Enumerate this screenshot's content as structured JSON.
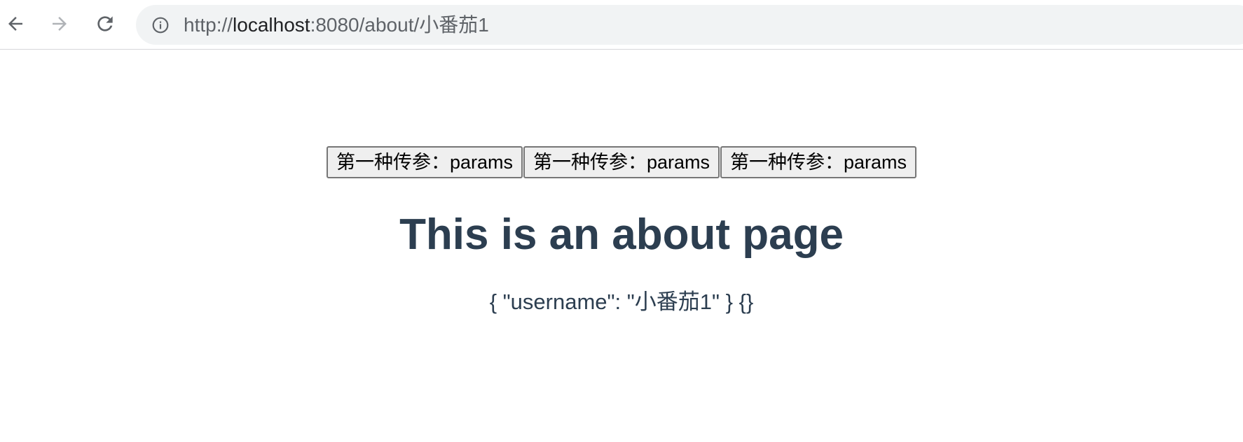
{
  "browser": {
    "url": {
      "scheme": "http://",
      "host": "localhost",
      "path": ":8080/about/小番茄1"
    },
    "icons": {
      "back": "arrow-left-icon",
      "forward": "arrow-right-icon",
      "reload": "reload-icon",
      "info": "info-circle-icon"
    },
    "colors": {
      "omnibox_bg": "#f1f3f4",
      "icon_active": "#5f6368",
      "icon_disabled": "#b0b3b7"
    }
  },
  "page": {
    "buttons": [
      {
        "label": "第一种传参：params"
      },
      {
        "label": "第一种传参：params"
      },
      {
        "label": "第一种传参：params"
      }
    ],
    "heading": "This is an about page",
    "params_text": "{ \"username\": \"小番茄1\" } {}",
    "colors": {
      "text": "#2c3e50"
    }
  }
}
